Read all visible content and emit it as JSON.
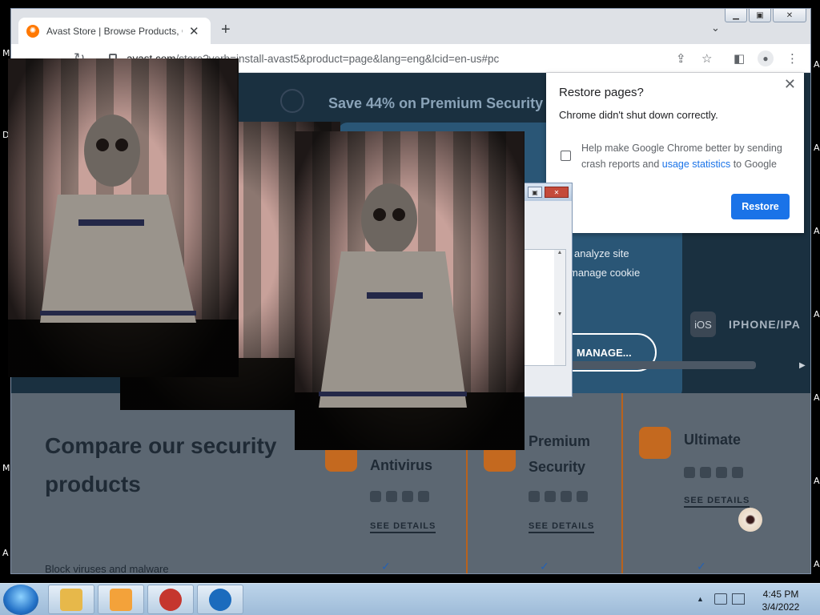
{
  "tab": {
    "title": "Avast Store | Browse Products, Offers",
    "favicon": "avast-logo-icon"
  },
  "address": {
    "host": "avast.com",
    "path": "/store?verb=install-avast5&product=page&lang=eng&lcid=en-us#pc"
  },
  "page": {
    "promo": "Save 44% on Premium Security",
    "cookie_line1": "analyze site",
    "cookie_line2": "manage cookie",
    "manage_button": "MANAGE...",
    "platform_icon": "iOS",
    "platform_label": "IPHONE/IPA",
    "compare_title": "Compare our security products",
    "products": [
      {
        "name": "Antivirus",
        "link": "SEE DETAILS"
      },
      {
        "name": "Premium Security",
        "link": "SEE DETAILS"
      },
      {
        "name": "Ultimate",
        "link": "SEE DETAILS"
      }
    ],
    "block_text": "Block viruses and malware",
    "check": "✓"
  },
  "restore": {
    "title": "Restore pages?",
    "message": "Chrome didn't shut down correctly.",
    "help_prefix": "Help make Google Chrome better by sending crash reports and ",
    "help_link": "usage statistics",
    "help_suffix": " to Google",
    "button": "Restore"
  },
  "clock": {
    "time": "4:45 PM",
    "date": "3/4/2022"
  },
  "colors": {
    "accent": "#1a73e8",
    "avast_orange": "#ff7800"
  }
}
